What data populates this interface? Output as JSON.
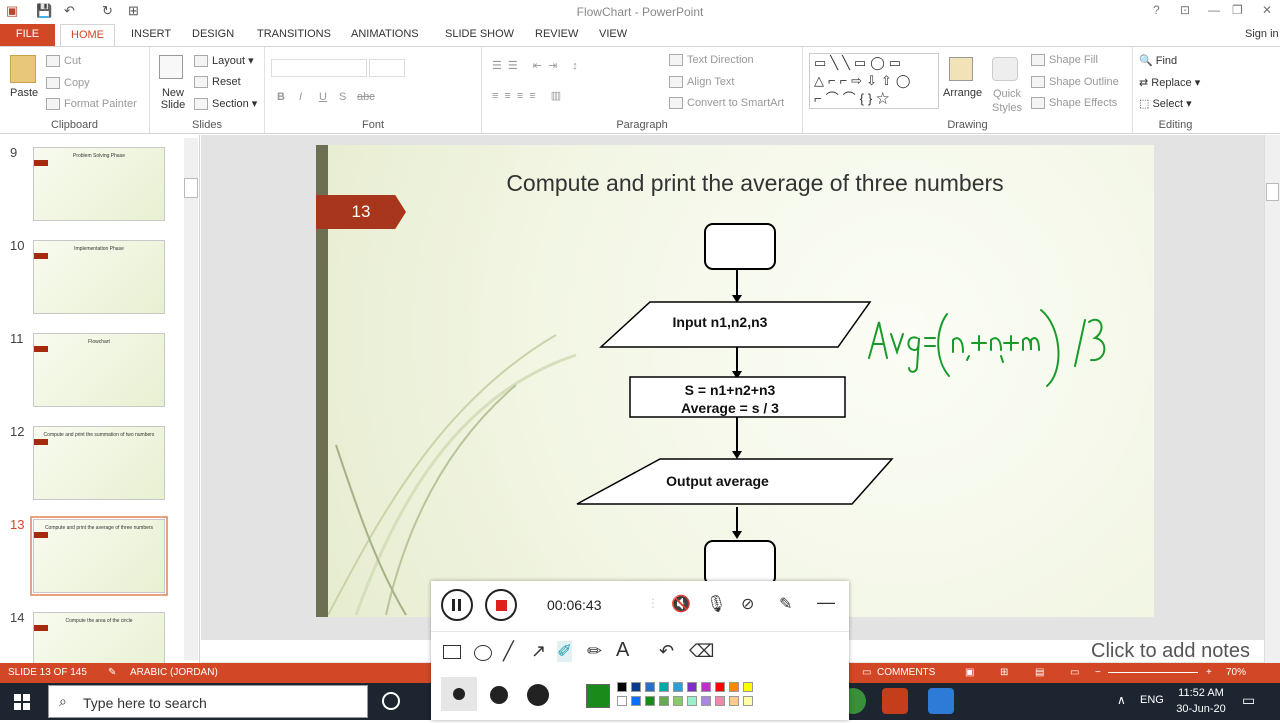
{
  "window": {
    "title": "FlowChart - PowerPoint",
    "signin": "Sign in"
  },
  "tabs": [
    "FILE",
    "HOME",
    "INSERT",
    "DESIGN",
    "TRANSITIONS",
    "ANIMATIONS",
    "SLIDE SHOW",
    "REVIEW",
    "VIEW"
  ],
  "ribbon": {
    "clipboard": {
      "label": "Clipboard",
      "paste": "Paste",
      "cut": "Cut",
      "copy": "Copy",
      "format_painter": "Format Painter"
    },
    "slides": {
      "label": "Slides",
      "new_slide": "New Slide",
      "layout": "Layout",
      "reset": "Reset",
      "section": "Section"
    },
    "font": {
      "label": "Font",
      "bold": "B",
      "italic": "I",
      "underline": "U",
      "shadow": "S",
      "strike": "abc"
    },
    "paragraph": {
      "label": "Paragraph",
      "text_direction": "Text Direction",
      "align_text": "Align Text",
      "convert_smartart": "Convert to SmartArt"
    },
    "drawing": {
      "label": "Drawing",
      "arrange": "Arrange",
      "quick_styles": "Quick Styles",
      "shape_fill": "Shape Fill",
      "shape_outline": "Shape Outline",
      "shape_effects": "Shape Effects"
    },
    "editing": {
      "label": "Editing",
      "find": "Find",
      "replace": "Replace",
      "select": "Select"
    }
  },
  "thumbnails": [
    {
      "num": "9",
      "title": "Problem Solving Phase"
    },
    {
      "num": "10",
      "title": "Implementation Phase"
    },
    {
      "num": "11",
      "title": "Flowchart"
    },
    {
      "num": "12",
      "title": "Compute and print the summation of two numbers"
    },
    {
      "num": "13",
      "title": "Compute and print the average of three numbers",
      "selected": true
    },
    {
      "num": "14",
      "title": "Compute the area of the circle"
    }
  ],
  "slide": {
    "number": "13",
    "title": "Compute and print the average of three numbers",
    "input": "Input n1,n2,n3",
    "process_line1": "S = n1+n2+n3",
    "process_line2": "Average = s / 3",
    "output": "Output average",
    "handwriting": "Avg=(n1+n2+n3)/3"
  },
  "notes_placeholder": "Click to add notes",
  "status": {
    "slide": "SLIDE 13 OF 145",
    "language": "ARABIC (JORDAN)",
    "comments": "COMMENTS",
    "zoom": "70%"
  },
  "taskbar": {
    "search_placeholder": "Type here to search",
    "lang": "ENG",
    "time": "11:52 AM",
    "date": "30-Jun-20"
  },
  "recorder": {
    "elapsed": "00:06:43"
  },
  "colors": {
    "accent": "#d24726",
    "ink": "#1a9a2a"
  }
}
